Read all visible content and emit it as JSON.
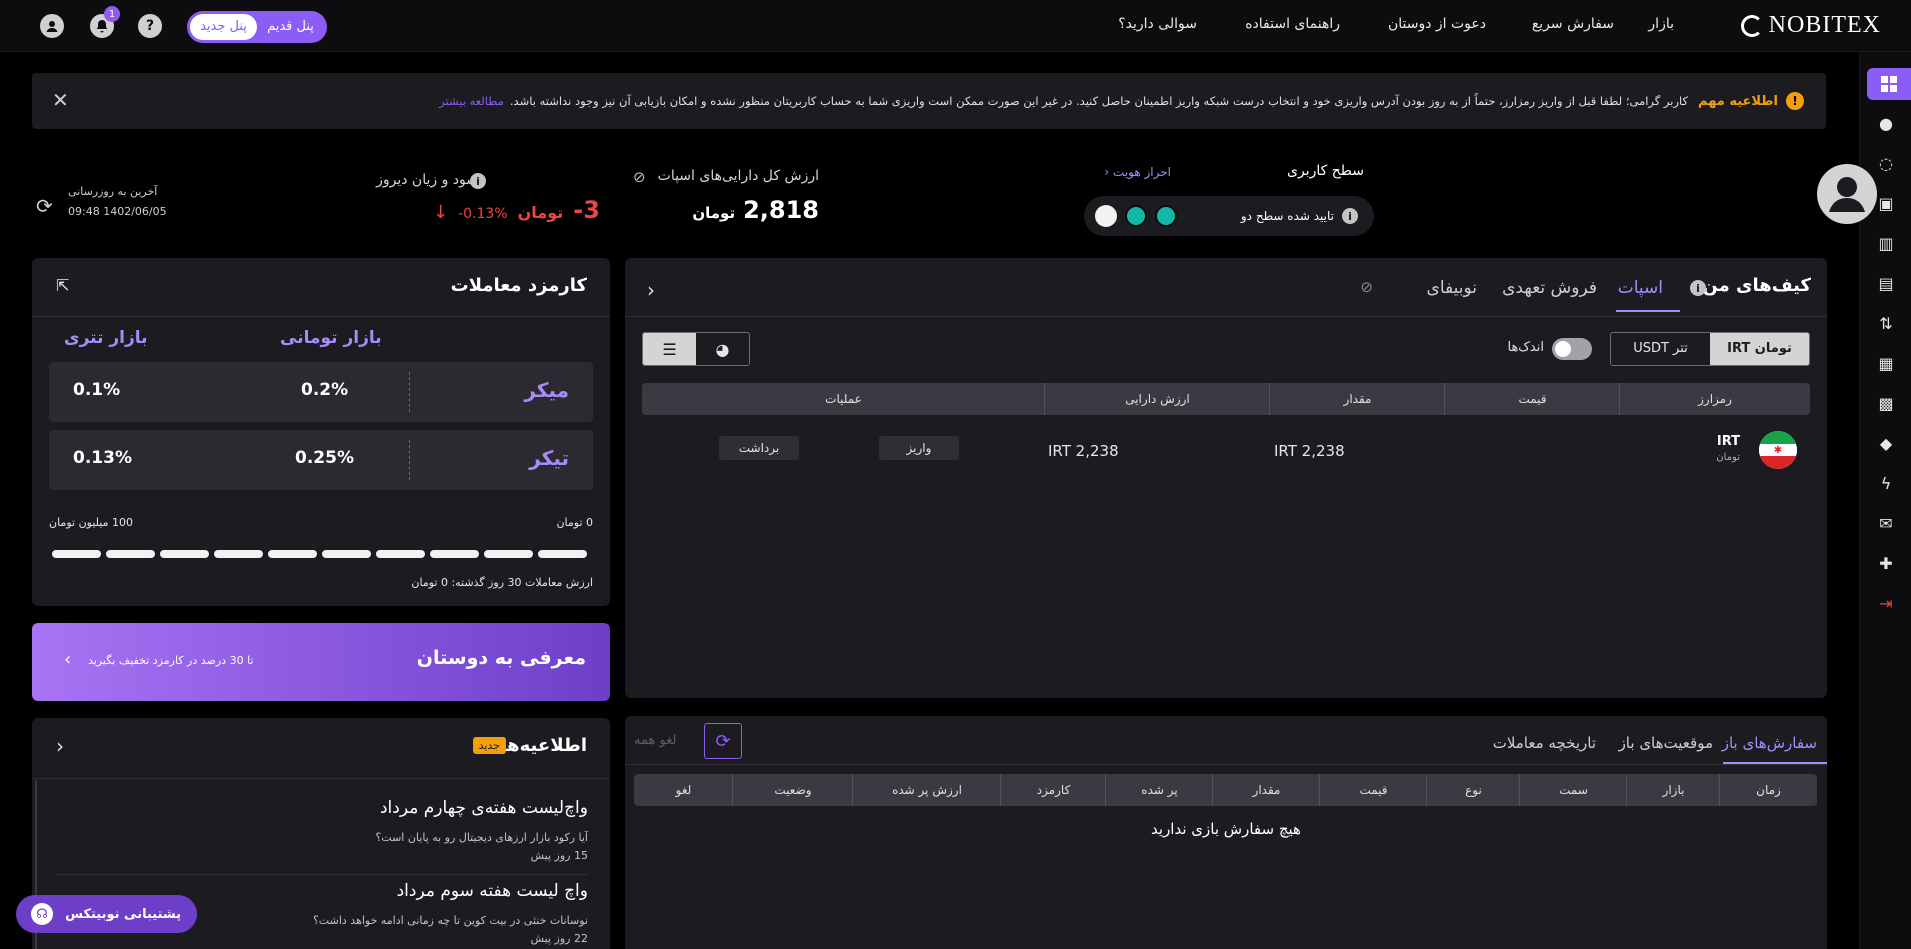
{
  "nav": {
    "logo": "NOBITEX",
    "items": [
      "بازار",
      "سفارش سریع",
      "دعوت از دوستان",
      "راهنمای استفاده",
      "سوالی دارید؟"
    ],
    "panel_new": "پنل جدید",
    "panel_old": "پنل قدیم",
    "notification_count": "1"
  },
  "notice": {
    "title": "اطلاعیه مهم",
    "text": "کاربر گرامی؛ لطفا قبل از واریز رمزارز، حتماً از به روز بودن آدرس واریزی خود و انتخاب درست شبکه واریز اطمینان حاصل کنید. در غیر این صورت ممکن است واریزی شما به حساب کاربریتان منظور نشده و امکان بازیابی آن نیز وجود نداشته باشد.",
    "more": "مطالعه بیشتر"
  },
  "summary": {
    "user_level_label": "سطح کاربری",
    "verify_link": "احراز هویت",
    "level_status": "تایید شده سطح دو",
    "spot_value_label": "ارزش کل دارایی‌های اسپات",
    "spot_value": "2,818",
    "spot_unit": "تومان",
    "pnl_label": "سود و زیان دیروز",
    "pnl_value": "-3",
    "pnl_unit": "تومان",
    "pnl_percent": "-0.13%",
    "last_update_label": "آخرین به روزرسانی",
    "last_update": "09:48 1402/06/05"
  },
  "wallet": {
    "title": "کیف‌های من",
    "tabs": [
      "اسپات",
      "فروش تعهدی",
      "نوبیفای"
    ],
    "currency_irt": "تومان IRT",
    "currency_usdt": "تتر USDT",
    "small_toggle_label": "اندک‌ها",
    "columns": [
      "رمزارز",
      "قیمت",
      "مقدار",
      "ارزش دارایی",
      "عملیات"
    ],
    "rows": [
      {
        "symbol": "IRT",
        "name": "تومان",
        "amount": "IRT 2,238",
        "asset_value": "IRT 2,238",
        "deposit": "واریز",
        "withdraw": "برداشت"
      }
    ]
  },
  "fees": {
    "title": "کارمزد معاملات",
    "toman_market": "بازار تومانی",
    "tether_market": "بازار تتری",
    "maker_label": "میکر",
    "maker_toman": "0.2%",
    "maker_tether": "0.1%",
    "taker_label": "تیکر",
    "taker_toman": "0.25%",
    "taker_tether": "0.13%",
    "range_min": "0 تومان",
    "range_max": "100 میلیون تومان",
    "volume_30d": "ارزش معاملات 30 روز گذشته: 0 تومان"
  },
  "referral": {
    "title": "معرفی به دوستان",
    "subtitle": "تا 30 درصد در کارمزد تخفیف بگیرید"
  },
  "orders": {
    "tabs": [
      "سفارش‌های باز",
      "موقعیت‌های باز",
      "تاریخچه معاملات"
    ],
    "cancel_all": "لغو همه",
    "columns": [
      "زمان",
      "بازار",
      "سمت",
      "نوع",
      "قیمت",
      "مقدار",
      "پر شده",
      "کارمزد",
      "ارزش پر شده",
      "وضعیت",
      "لغو"
    ],
    "empty": "هیچ سفارش بازی ندارید"
  },
  "news": {
    "title": "اطلاعیه‌ها",
    "badge": "جدید",
    "items": [
      {
        "title": "واچ‌لیست هفته‌ی چهارم مرداد",
        "desc": "آیا رکود بازار ارزهای دیجیتال رو به پایان است؟",
        "time": "15 روز پیش"
      },
      {
        "title": "واچ لیست هفته سوم مرداد",
        "desc": "نوسانات خنثی در بیت کوین تا چه زمانی ادامه خواهد داشت؟",
        "time": "22 روز پیش"
      }
    ]
  },
  "support": {
    "label": "پشتیبانی نوبیتکس"
  },
  "colors": {
    "accent": "#8b5cf6",
    "positive": "#14b8a6",
    "negative": "#ef4444",
    "warning": "#f59e0b"
  }
}
